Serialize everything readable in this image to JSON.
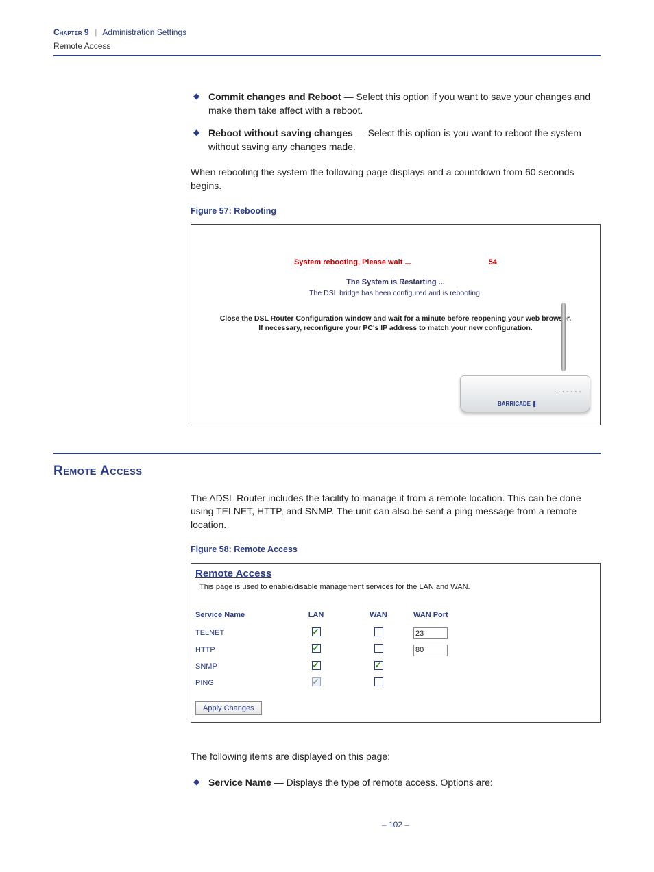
{
  "header": {
    "chapter": "Chapter 9",
    "title": "Administration Settings",
    "subtitle": "Remote Access"
  },
  "bullets": [
    {
      "bold": "Commit changes and Reboot",
      "text": " — Select this option if you want to save your changes and make them take affect with a reboot."
    },
    {
      "bold": "Reboot without saving changes",
      "text": " — Select this option is you want to reboot the system without saving any changes made."
    }
  ],
  "reboot_intro": "When rebooting the system the following page displays and a countdown from 60 seconds begins.",
  "fig57": {
    "caption": "Figure 57:  Rebooting",
    "title": "System rebooting, Please wait ...",
    "countdown": "54",
    "restart": "The System is Restarting ...",
    "bridge": "The DSL bridge has been configured and is rebooting.",
    "instr1": "Close the DSL Router Configuration window and wait for a minute before reopening your web browser.",
    "instr2": "If necessary, reconfigure your PC's IP address to match your new configuration."
  },
  "section": {
    "title": "Remote Access",
    "para": "The ADSL Router includes the facility to manage it from a remote location. This can be done using TELNET, HTTP, and SNMP. The unit can also be sent a ping message from a remote location."
  },
  "fig58": {
    "caption": "Figure 58:  Remote Access",
    "title": "Remote Access",
    "desc": "This page is used to enable/disable management services for the LAN and WAN.",
    "headers": {
      "service": "Service Name",
      "lan": "LAN",
      "wan": "WAN",
      "port": "WAN Port"
    },
    "rows": [
      {
        "name": "TELNET",
        "lan": true,
        "lan_disabled": false,
        "wan": false,
        "wan_disabled": false,
        "port": "23"
      },
      {
        "name": "HTTP",
        "lan": true,
        "lan_disabled": false,
        "wan": false,
        "wan_disabled": false,
        "port": "80"
      },
      {
        "name": "SNMP",
        "lan": true,
        "lan_disabled": false,
        "wan": true,
        "wan_disabled": false,
        "port": ""
      },
      {
        "name": "PING",
        "lan": true,
        "lan_disabled": true,
        "wan": false,
        "wan_disabled": false,
        "port": ""
      }
    ],
    "apply": "Apply Changes"
  },
  "post": {
    "intro": "The following items are displayed on this page:",
    "item_bold": "Service Name",
    "item_text": " — Displays the type of remote access. Options are:"
  },
  "page_number": "–  102  –"
}
